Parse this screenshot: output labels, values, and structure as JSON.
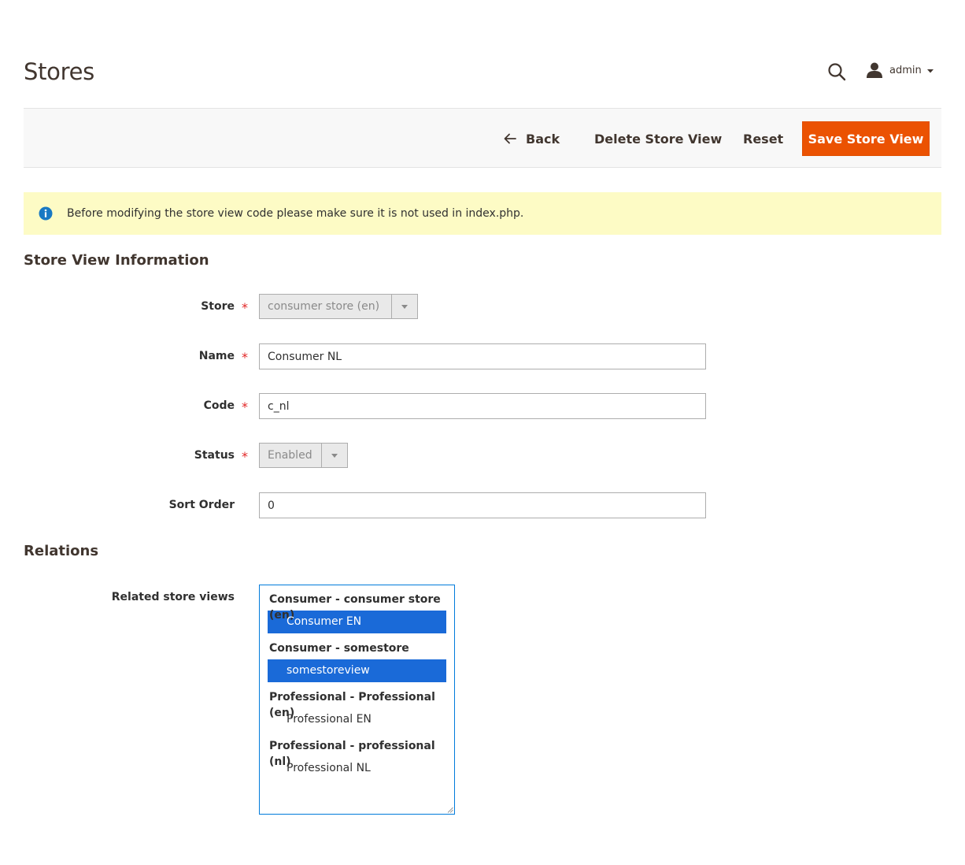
{
  "header": {
    "title": "Stores",
    "user_name": "admin"
  },
  "actions": {
    "back_label": "Back",
    "delete_label": "Delete Store View",
    "reset_label": "Reset",
    "save_label": "Save Store View"
  },
  "notice": {
    "text": "Before modifying the store view code please make sure it is not used in index.php."
  },
  "store_view_info": {
    "title": "Store View Information",
    "fields": {
      "store": {
        "label": "Store",
        "value": "consumer store (en)",
        "required": true
      },
      "name": {
        "label": "Name",
        "value": "Consumer NL",
        "required": true
      },
      "code": {
        "label": "Code",
        "value": "c_nl",
        "required": true
      },
      "status": {
        "label": "Status",
        "value": "Enabled",
        "required": true
      },
      "sort_order": {
        "label": "Sort Order",
        "value": "0",
        "required": false
      }
    },
    "required_mark": "*"
  },
  "relations": {
    "title": "Relations",
    "related_label": "Related store views",
    "groups": [
      {
        "label": "Consumer - consumer store (en)",
        "options": [
          {
            "label": "Consumer EN",
            "selected": true
          }
        ]
      },
      {
        "label": "Consumer - somestore",
        "options": [
          {
            "label": "somestoreview",
            "selected": true
          }
        ]
      },
      {
        "label": "Professional - Professional (en)",
        "options": [
          {
            "label": "Professional EN",
            "selected": false
          }
        ]
      },
      {
        "label": "Professional - professional (nl)",
        "options": [
          {
            "label": "Professional NL",
            "selected": false
          }
        ]
      }
    ]
  },
  "colors": {
    "primary_button": "#eb5202",
    "notice_bg": "#fdfbc5",
    "selected_option": "#1a6ad8",
    "required_star": "#e22626"
  },
  "icons": [
    "search-icon",
    "user-icon",
    "chevron-down-icon",
    "arrow-left-icon",
    "info-icon"
  ]
}
